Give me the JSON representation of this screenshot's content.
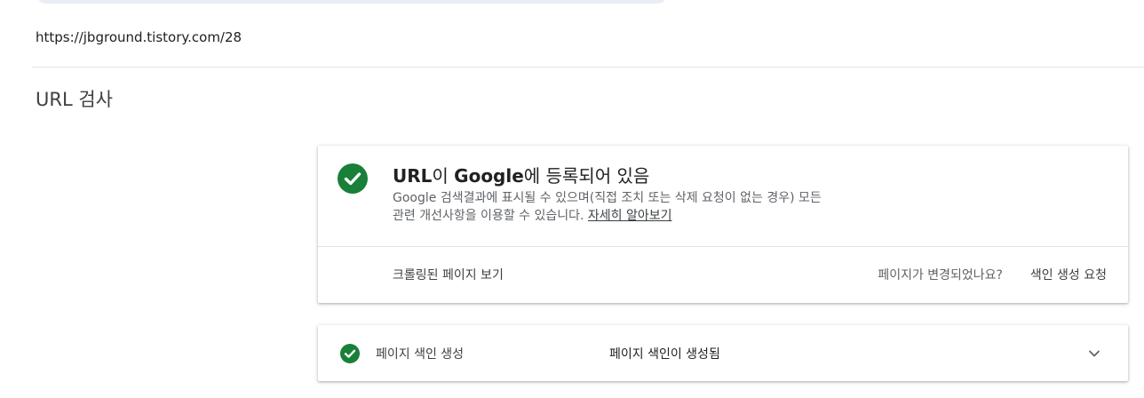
{
  "header": {
    "url": "https://jbground.tistory.com/28",
    "page_title": "URL 검사"
  },
  "status_card": {
    "title_prefix": "URL",
    "title_mid1": "이 ",
    "title_brand": "Google",
    "title_suffix": "에 등록되어 있음",
    "description_line1": "Google 검색결과에 표시될 수 있으며(직접 조치 또는 삭제 요청이 없는 경우) 모든",
    "description_line2": "관련 개선사항을 이용할 수 있습니다.",
    "learn_more": "자세히 알아보기",
    "view_crawled": "크롤링된 페이지 보기",
    "page_changed_question": "페이지가 변경되었나요?",
    "request_indexing": "색인 생성 요청"
  },
  "indexing_card": {
    "label": "페이지 색인 생성",
    "value": "페이지 색인이 생성됨"
  },
  "colors": {
    "success_green": "#188038",
    "divider": "#e3e3e3",
    "search_pill": "#e9eef6"
  },
  "icons": {
    "status": "check-circle-icon",
    "expand": "chevron-down-icon"
  }
}
